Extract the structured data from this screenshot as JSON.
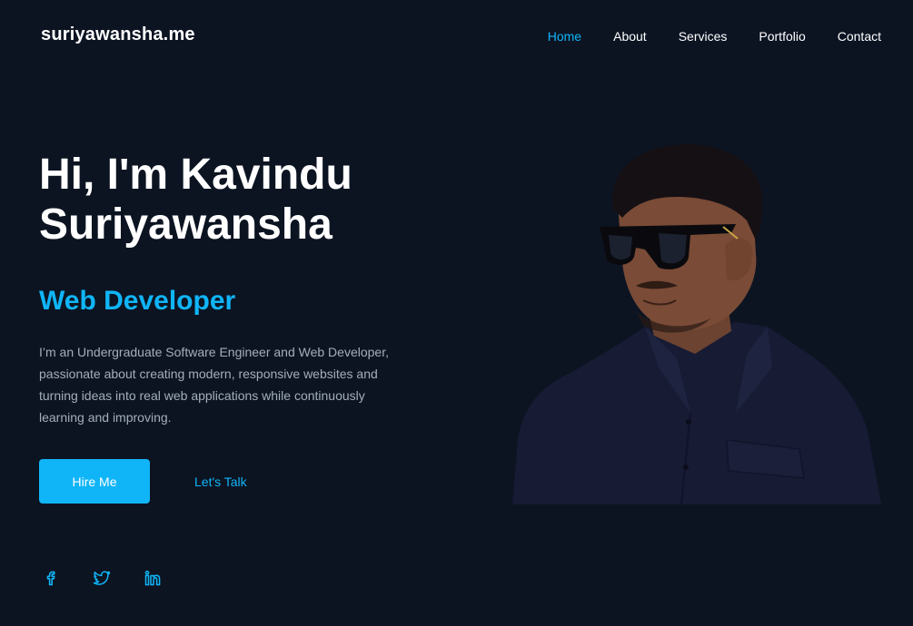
{
  "brand": {
    "logo": "suriyawansha.me"
  },
  "nav": {
    "items": [
      {
        "label": "Home",
        "active": true
      },
      {
        "label": "About",
        "active": false
      },
      {
        "label": "Services",
        "active": false
      },
      {
        "label": "Portfolio",
        "active": false
      },
      {
        "label": "Contact",
        "active": false
      }
    ]
  },
  "hero": {
    "title_line1": "Hi, I'm Kavindu",
    "title_line2": "Suriyawansha",
    "role": "Web Developer",
    "bio": "I’m an Undergraduate Software Engineer and Web Developer, passionate about creating modern, responsive websites and turning ideas into real web applications while continuously learning and improving.",
    "primary_button": "Hire Me",
    "secondary_button": "Let's Talk"
  },
  "socials": {
    "items": [
      {
        "icon": "facebook-icon"
      },
      {
        "icon": "twitter-icon"
      },
      {
        "icon": "linkedin-icon"
      }
    ]
  },
  "colors": {
    "background": "#0c1422",
    "accent": "#10b5f7",
    "text": "#ffffff",
    "muted": "#a4aebb"
  }
}
